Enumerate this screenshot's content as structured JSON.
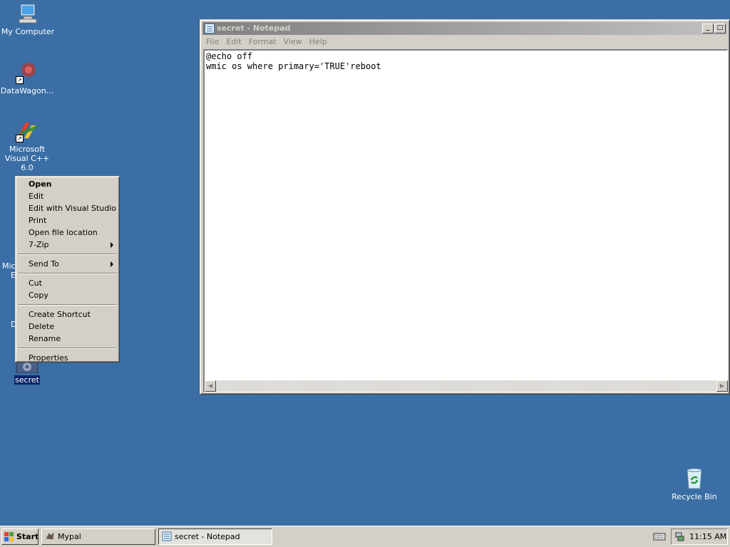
{
  "desktop": {
    "background": "#3a6ea5",
    "icons": [
      {
        "label": "My Computer",
        "icon": "computer-icon"
      },
      {
        "label": "DataWagon...",
        "icon": "datawagon-icon"
      },
      {
        "label": "Microsoft Visual C++ 6.0",
        "icon": "visual-cpp-icon"
      },
      {
        "label": "Micr",
        "icon": "partially-hidden-icon"
      },
      {
        "label": "E",
        "icon": "partially-hidden-icon"
      },
      {
        "label": "D",
        "icon": "partially-hidden-icon"
      },
      {
        "label": "secret",
        "icon": "batch-file-icon"
      },
      {
        "label": "Recycle Bin",
        "icon": "recycle-bin-icon"
      }
    ]
  },
  "notepad": {
    "title": "secret - Notepad",
    "menu": [
      "File",
      "Edit",
      "Format",
      "View",
      "Help"
    ],
    "content": "@echo off\nwmic os where primary='TRUE'reboot",
    "minimize_glyph": "_",
    "maximize_glyph": "□",
    "scroll_left_glyph": "◀",
    "scroll_right_glyph": "▶"
  },
  "context_menu": {
    "items": [
      {
        "label": "Open",
        "bold": true
      },
      {
        "label": "Edit"
      },
      {
        "label": "Edit with Visual Studio"
      },
      {
        "label": "Print"
      },
      {
        "label": "Open file location"
      },
      {
        "label": "7-Zip",
        "submenu": true
      },
      {
        "separator": true
      },
      {
        "label": "Send To",
        "submenu": true
      },
      {
        "separator": true
      },
      {
        "label": "Cut"
      },
      {
        "label": "Copy"
      },
      {
        "separator": true
      },
      {
        "label": "Create Shortcut"
      },
      {
        "label": "Delete"
      },
      {
        "label": "Rename"
      },
      {
        "separator": true
      },
      {
        "label": "Properties"
      }
    ]
  },
  "taskbar": {
    "start_label": "Start",
    "tasks": [
      {
        "label": "Mypal",
        "icon": "mypal-icon"
      },
      {
        "label": "secret - Notepad",
        "icon": "notepad-icon"
      }
    ],
    "clock": "11:15 AM"
  }
}
